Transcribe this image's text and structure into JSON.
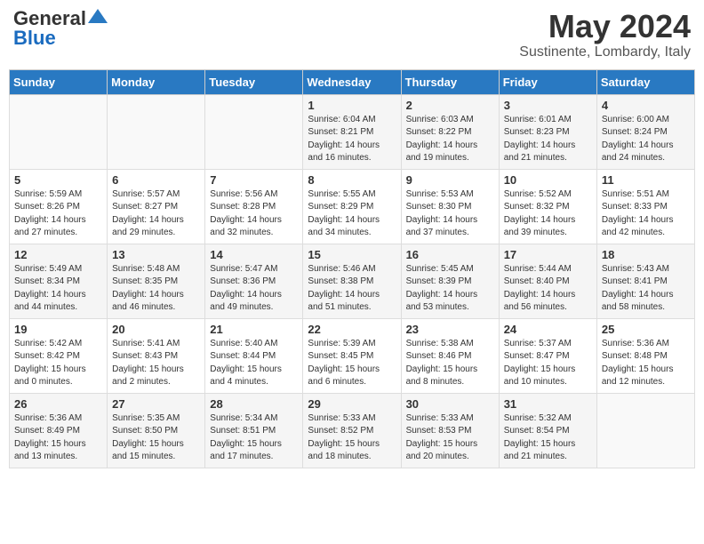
{
  "header": {
    "logo_general": "General",
    "logo_blue": "Blue",
    "month_title": "May 2024",
    "location": "Sustinente, Lombardy, Italy"
  },
  "days_of_week": [
    "Sunday",
    "Monday",
    "Tuesday",
    "Wednesday",
    "Thursday",
    "Friday",
    "Saturday"
  ],
  "weeks": [
    [
      {
        "day": "",
        "info": ""
      },
      {
        "day": "",
        "info": ""
      },
      {
        "day": "",
        "info": ""
      },
      {
        "day": "1",
        "info": "Sunrise: 6:04 AM\nSunset: 8:21 PM\nDaylight: 14 hours\nand 16 minutes."
      },
      {
        "day": "2",
        "info": "Sunrise: 6:03 AM\nSunset: 8:22 PM\nDaylight: 14 hours\nand 19 minutes."
      },
      {
        "day": "3",
        "info": "Sunrise: 6:01 AM\nSunset: 8:23 PM\nDaylight: 14 hours\nand 21 minutes."
      },
      {
        "day": "4",
        "info": "Sunrise: 6:00 AM\nSunset: 8:24 PM\nDaylight: 14 hours\nand 24 minutes."
      }
    ],
    [
      {
        "day": "5",
        "info": "Sunrise: 5:59 AM\nSunset: 8:26 PM\nDaylight: 14 hours\nand 27 minutes."
      },
      {
        "day": "6",
        "info": "Sunrise: 5:57 AM\nSunset: 8:27 PM\nDaylight: 14 hours\nand 29 minutes."
      },
      {
        "day": "7",
        "info": "Sunrise: 5:56 AM\nSunset: 8:28 PM\nDaylight: 14 hours\nand 32 minutes."
      },
      {
        "day": "8",
        "info": "Sunrise: 5:55 AM\nSunset: 8:29 PM\nDaylight: 14 hours\nand 34 minutes."
      },
      {
        "day": "9",
        "info": "Sunrise: 5:53 AM\nSunset: 8:30 PM\nDaylight: 14 hours\nand 37 minutes."
      },
      {
        "day": "10",
        "info": "Sunrise: 5:52 AM\nSunset: 8:32 PM\nDaylight: 14 hours\nand 39 minutes."
      },
      {
        "day": "11",
        "info": "Sunrise: 5:51 AM\nSunset: 8:33 PM\nDaylight: 14 hours\nand 42 minutes."
      }
    ],
    [
      {
        "day": "12",
        "info": "Sunrise: 5:49 AM\nSunset: 8:34 PM\nDaylight: 14 hours\nand 44 minutes."
      },
      {
        "day": "13",
        "info": "Sunrise: 5:48 AM\nSunset: 8:35 PM\nDaylight: 14 hours\nand 46 minutes."
      },
      {
        "day": "14",
        "info": "Sunrise: 5:47 AM\nSunset: 8:36 PM\nDaylight: 14 hours\nand 49 minutes."
      },
      {
        "day": "15",
        "info": "Sunrise: 5:46 AM\nSunset: 8:38 PM\nDaylight: 14 hours\nand 51 minutes."
      },
      {
        "day": "16",
        "info": "Sunrise: 5:45 AM\nSunset: 8:39 PM\nDaylight: 14 hours\nand 53 minutes."
      },
      {
        "day": "17",
        "info": "Sunrise: 5:44 AM\nSunset: 8:40 PM\nDaylight: 14 hours\nand 56 minutes."
      },
      {
        "day": "18",
        "info": "Sunrise: 5:43 AM\nSunset: 8:41 PM\nDaylight: 14 hours\nand 58 minutes."
      }
    ],
    [
      {
        "day": "19",
        "info": "Sunrise: 5:42 AM\nSunset: 8:42 PM\nDaylight: 15 hours\nand 0 minutes."
      },
      {
        "day": "20",
        "info": "Sunrise: 5:41 AM\nSunset: 8:43 PM\nDaylight: 15 hours\nand 2 minutes."
      },
      {
        "day": "21",
        "info": "Sunrise: 5:40 AM\nSunset: 8:44 PM\nDaylight: 15 hours\nand 4 minutes."
      },
      {
        "day": "22",
        "info": "Sunrise: 5:39 AM\nSunset: 8:45 PM\nDaylight: 15 hours\nand 6 minutes."
      },
      {
        "day": "23",
        "info": "Sunrise: 5:38 AM\nSunset: 8:46 PM\nDaylight: 15 hours\nand 8 minutes."
      },
      {
        "day": "24",
        "info": "Sunrise: 5:37 AM\nSunset: 8:47 PM\nDaylight: 15 hours\nand 10 minutes."
      },
      {
        "day": "25",
        "info": "Sunrise: 5:36 AM\nSunset: 8:48 PM\nDaylight: 15 hours\nand 12 minutes."
      }
    ],
    [
      {
        "day": "26",
        "info": "Sunrise: 5:36 AM\nSunset: 8:49 PM\nDaylight: 15 hours\nand 13 minutes."
      },
      {
        "day": "27",
        "info": "Sunrise: 5:35 AM\nSunset: 8:50 PM\nDaylight: 15 hours\nand 15 minutes."
      },
      {
        "day": "28",
        "info": "Sunrise: 5:34 AM\nSunset: 8:51 PM\nDaylight: 15 hours\nand 17 minutes."
      },
      {
        "day": "29",
        "info": "Sunrise: 5:33 AM\nSunset: 8:52 PM\nDaylight: 15 hours\nand 18 minutes."
      },
      {
        "day": "30",
        "info": "Sunrise: 5:33 AM\nSunset: 8:53 PM\nDaylight: 15 hours\nand 20 minutes."
      },
      {
        "day": "31",
        "info": "Sunrise: 5:32 AM\nSunset: 8:54 PM\nDaylight: 15 hours\nand 21 minutes."
      },
      {
        "day": "",
        "info": ""
      }
    ]
  ]
}
